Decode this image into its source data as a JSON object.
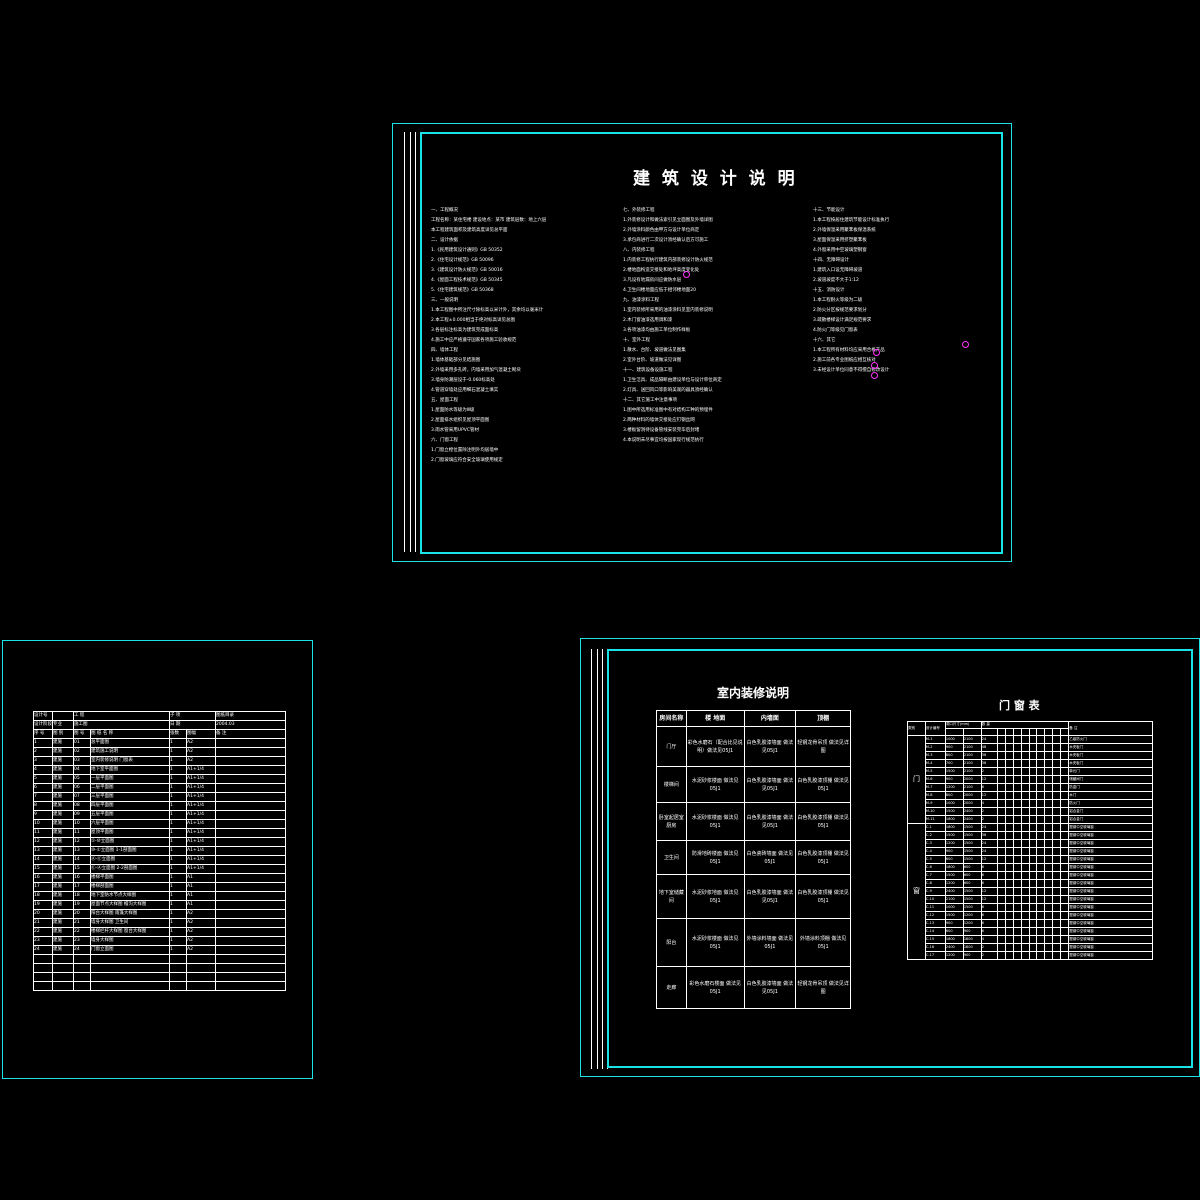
{
  "sheet_design_notes": {
    "title": "建 筑 设 计 说 明",
    "col1": [
      "一、工程概况",
      "工程名称：某住宅楼 建设地点：某市 建筑层数：地上六层",
      "本工程建筑面积及建筑高度详见总平面",
      "二、设计依据",
      "1.《民用建筑设计通则》GB 50352",
      "2.《住宅设计规范》GB 50096",
      "3.《建筑设计防火规范》GB 50016",
      "4.《屋面工程技术规范》GB 50345",
      "5.《住宅建筑规范》GB 50368",
      "三、一般说明",
      "1.本工程图中所注尺寸除标高以米计外，其余均以毫米计",
      "2.本工程±0.000相当于绝对标高详见总图",
      "3.各层标注标高为建筑完成面标高",
      "4.施工中应严格遵守国家各项施工验收规范",
      "四、墙体工程",
      "1.墙体基础部分见结施图",
      "2.外墙采用多孔砖，内墙采用加气混凝土砌块",
      "3.墙身防潮层设于-0.060标高处",
      "4.管道穿墙处应用细石混凝土填实",
      "五、屋面工程",
      "1.屋面防水等级为Ⅲ级",
      "2.屋面排水组织见屋顶平面图",
      "3.雨水管采用UPVC管材",
      "六、门窗工程",
      "1.门窗立樘位置除注明外均居墙中",
      "2.门窗玻璃应符合安全玻璃使用规定"
    ],
    "col2": [
      "七、外装修工程",
      "1.外装修设计和做法索引见立面图及外墙详图",
      "2.外墙涂料颜色由甲方与设计单位商定",
      "3.承包商进行二次设计须经确认后方可施工",
      "八、内装修工程",
      "1.内装修工程执行建筑内部装修设计防火规范",
      "2.楼地面构造交接处和地坪高度变化处",
      "3.凡设有地漏房间应做防水层",
      "4.卫生间楼地面应低于相邻楼地面20",
      "九、油漆涂料工程",
      "1.室内装修所采用的油漆涂料见室内装修说明",
      "2.木门窗油漆选用调和漆",
      "3.各项油漆均由施工单位制作样板",
      "十、室外工程",
      "1.散水、台阶、坡道做法见图集",
      "2.室外台阶、坡道做法见详图",
      "十一、建筑设备设施工程",
      "1.卫生洁具、成品隔断由建设单位与设计单位商定",
      "2.灯具、送回风口等影响美观的器具须经确认",
      "十二、其它施工中注意事项",
      "1.图中所选用标准图中有对结构工种的预埋件",
      "2.两种材料的墙体交接处应钉钢丝网",
      "3.楼板留洞待设备管线安装完毕后封堵",
      "4.本说明未尽事宜均按国家现行规范执行"
    ],
    "col3": [
      "十三、节能设计",
      "1.本工程按居住建筑节能设计标准执行",
      "2.外墙保温采用聚苯板保温系统",
      "3.屋面保温采用挤塑聚苯板",
      "4.外窗采用中空玻璃塑钢窗",
      "十四、无障碍设计",
      "1.建筑入口设无障碍坡道",
      "2.坡道坡度不大于1:12",
      "十五、消防设计",
      "1.本工程耐火等级为二级",
      "2.防火分区按规范要求划分",
      "3.疏散楼梯设计满足规范要求",
      "4.防火门等级见门窗表",
      "十六、其它",
      "1.本工程所有材料均应采用合格产品",
      "2.施工前各专业图纸应相互核对",
      "3.未经设计单位同意不得擅自修改设计"
    ]
  },
  "sheet_drawing_list": {
    "head_labels": [
      "设计号",
      "工 程",
      "子 项",
      "设计阶段",
      "专业",
      "施工图",
      "图纸目录",
      "日 期"
    ],
    "date": "2004.03",
    "columns": [
      "序 号",
      "图 别",
      "图 号",
      "图 纸 名 称",
      "张数",
      "图幅",
      "备 注"
    ],
    "rows": [
      [
        "1",
        "建施",
        "01",
        "总平面图",
        "1",
        "A2",
        ""
      ],
      [
        "2",
        "建施",
        "02",
        "建筑施工说明",
        "1",
        "A2",
        ""
      ],
      [
        "3",
        "建施",
        "03",
        "室内装修说明 门窗表",
        "1",
        "A2",
        ""
      ],
      [
        "4",
        "建施",
        "04",
        "地下室平面图",
        "1",
        "A1+1/4",
        ""
      ],
      [
        "5",
        "建施",
        "05",
        "一层平面图",
        "1",
        "A1+1/4",
        ""
      ],
      [
        "6",
        "建施",
        "06",
        "二层平面图",
        "1",
        "A1+1/4",
        ""
      ],
      [
        "7",
        "建施",
        "07",
        "三层平面图",
        "1",
        "A1+1/4",
        ""
      ],
      [
        "8",
        "建施",
        "08",
        "四层平面图",
        "1",
        "A1+1/4",
        ""
      ],
      [
        "9",
        "建施",
        "09",
        "五层平面图",
        "1",
        "A1+1/4",
        ""
      ],
      [
        "10",
        "建施",
        "10",
        "六层平面图",
        "1",
        "A1+1/4",
        ""
      ],
      [
        "11",
        "建施",
        "11",
        "屋顶平面图",
        "1",
        "A1+1/4",
        ""
      ],
      [
        "12",
        "建施",
        "12",
        "①-⑩立面图",
        "1",
        "A1+1/4",
        ""
      ],
      [
        "13",
        "建施",
        "13",
        "⑩-①立面图 1-1剖面图",
        "1",
        "A1+1/4",
        ""
      ],
      [
        "14",
        "建施",
        "14",
        "Ⓐ-Ⓔ立面图",
        "1",
        "A1+1/4",
        ""
      ],
      [
        "15",
        "建施",
        "15",
        "Ⓔ-Ⓐ立面图 2-2剖面图",
        "1",
        "A1+1/4",
        ""
      ],
      [
        "16",
        "建施",
        "16",
        "楼梯平面图",
        "1",
        "A1",
        ""
      ],
      [
        "17",
        "建施",
        "17",
        "楼梯剖面图",
        "1",
        "A1",
        ""
      ],
      [
        "18",
        "建施",
        "18",
        "地下室防水节点大样图",
        "1",
        "A1",
        ""
      ],
      [
        "19",
        "建施",
        "19",
        "屋面节点大样图 檐沟大样图",
        "1",
        "A1",
        ""
      ],
      [
        "20",
        "建施",
        "20",
        "阳台大样图 雨篷大样图",
        "1",
        "A2",
        ""
      ],
      [
        "21",
        "建施",
        "21",
        "墙身大样图 卫生间",
        "1",
        "A2",
        ""
      ],
      [
        "22",
        "建施",
        "22",
        "楼梯栏杆大样图 窗台大样图",
        "1",
        "A2",
        ""
      ],
      [
        "23",
        "建施",
        "23",
        "墙身大样图",
        "1",
        "A2",
        ""
      ],
      [
        "24",
        "建施",
        "24",
        "门窗立面图",
        "1",
        "A2",
        ""
      ]
    ]
  },
  "sheet_finish": {
    "title": "室内装修说明",
    "columns": [
      "房间名称",
      "楼 地面",
      "内墙面",
      "顶棚"
    ],
    "rows": [
      [
        "门厅",
        "彩色水磨石（配合比见说明）做法见05J1",
        "白色乳胶漆墙面 做法见05J1",
        "轻钢龙骨吊顶 做法见详图"
      ],
      [
        "楼梯间",
        "水泥砂浆楼面 做法见05J1",
        "白色乳胶漆墙面 做法见05J1",
        "白色乳胶漆顶棚 做法见05J1"
      ],
      [
        "卧室起居室厨房",
        "水泥砂浆楼面 做法见05J1",
        "白色乳胶漆墙面 做法见05J1",
        "白色乳胶漆顶棚 做法见05J1"
      ],
      [
        "卫生间",
        "防滑地砖楼面 做法见05J1",
        "白色瓷砖墙面 做法见05J1",
        "白色乳胶漆顶棚 做法见05J1"
      ],
      [
        "地下室储藏间",
        "水泥砂浆地面 做法见05J1",
        "白色乳胶漆墙面 做法见05J1",
        "白色乳胶漆顶棚 做法见05J1"
      ],
      [
        "阳台",
        "水泥砂浆楼面 做法见05J1",
        "外墙涂料墙面 做法见05J1",
        "外墙涂料顶棚 做法见05J1"
      ],
      [
        "走廊",
        "彩色水磨石楼面 做法见05J1",
        "白色乳胶漆墙面 做法见05J1",
        "轻钢龙骨吊顶 做法见详图"
      ]
    ]
  },
  "sheet_doors": {
    "title": "门 窗 表",
    "head": [
      "类别",
      "设计编号",
      "洞口尺寸(mm)",
      "数 量",
      "备 注"
    ],
    "door_label": "门",
    "window_label": "窗",
    "door_rows": [
      [
        "M-1",
        "1000",
        "2100",
        "24",
        "乙级防火门"
      ],
      [
        "M-2",
        "900",
        "2100",
        "48",
        "木夹板门"
      ],
      [
        "M-3",
        "800",
        "2100",
        "36",
        "木夹板门"
      ],
      [
        "M-4",
        "700",
        "2100",
        "36",
        "木夹板门"
      ],
      [
        "M-5",
        "1500",
        "2100",
        "2",
        "单元门"
      ],
      [
        "M-6",
        "900",
        "2000",
        "12",
        "储藏间门"
      ],
      [
        "M-7",
        "1200",
        "2100",
        "6",
        "防盗门"
      ],
      [
        "M-8",
        "800",
        "2000",
        "12",
        "木门"
      ],
      [
        "M-9",
        "1000",
        "2000",
        "4",
        "防火门"
      ],
      [
        "M-10",
        "1500",
        "2400",
        "2",
        "铝合金门"
      ],
      [
        "M-11",
        "1800",
        "2400",
        "2",
        "铝合金门"
      ]
    ],
    "window_rows": [
      [
        "C-1",
        "1800",
        "1500",
        "24",
        "塑钢中空玻璃窗"
      ],
      [
        "C-2",
        "1500",
        "1500",
        "36",
        "塑钢中空玻璃窗"
      ],
      [
        "C-3",
        "1200",
        "1500",
        "24",
        "塑钢中空玻璃窗"
      ],
      [
        "C-4",
        "900",
        "1500",
        "24",
        "塑钢中空玻璃窗"
      ],
      [
        "C-5",
        "600",
        "1500",
        "12",
        "塑钢中空玻璃窗"
      ],
      [
        "C-6",
        "1800",
        "600",
        "6",
        "塑钢中空玻璃窗"
      ],
      [
        "C-7",
        "1500",
        "600",
        "6",
        "塑钢中空玻璃窗"
      ],
      [
        "C-8",
        "1200",
        "600",
        "6",
        "塑钢中空玻璃窗"
      ],
      [
        "C-9",
        "2400",
        "1500",
        "12",
        "塑钢中空玻璃窗"
      ],
      [
        "C-10",
        "2100",
        "1500",
        "12",
        "塑钢中空玻璃窗"
      ],
      [
        "C-11",
        "1000",
        "1500",
        "6",
        "塑钢中空玻璃窗"
      ],
      [
        "C-12",
        "1500",
        "1200",
        "6",
        "塑钢中空玻璃窗"
      ],
      [
        "C-13",
        "900",
        "1200",
        "6",
        "塑钢中空玻璃窗"
      ],
      [
        "C-14",
        "600",
        "900",
        "6",
        "塑钢中空玻璃窗"
      ],
      [
        "C-15",
        "1800",
        "1800",
        "4",
        "塑钢中空玻璃窗"
      ],
      [
        "C-16",
        "2400",
        "1800",
        "2",
        "塑钢中空玻璃窗"
      ],
      [
        "C-17",
        "1200",
        "900",
        "2",
        "塑钢中空玻璃窗"
      ]
    ]
  },
  "colors": {
    "frame": "#19e3e6",
    "line": "#ffffff",
    "mark": "#ff33ff",
    "background": "#000000"
  }
}
